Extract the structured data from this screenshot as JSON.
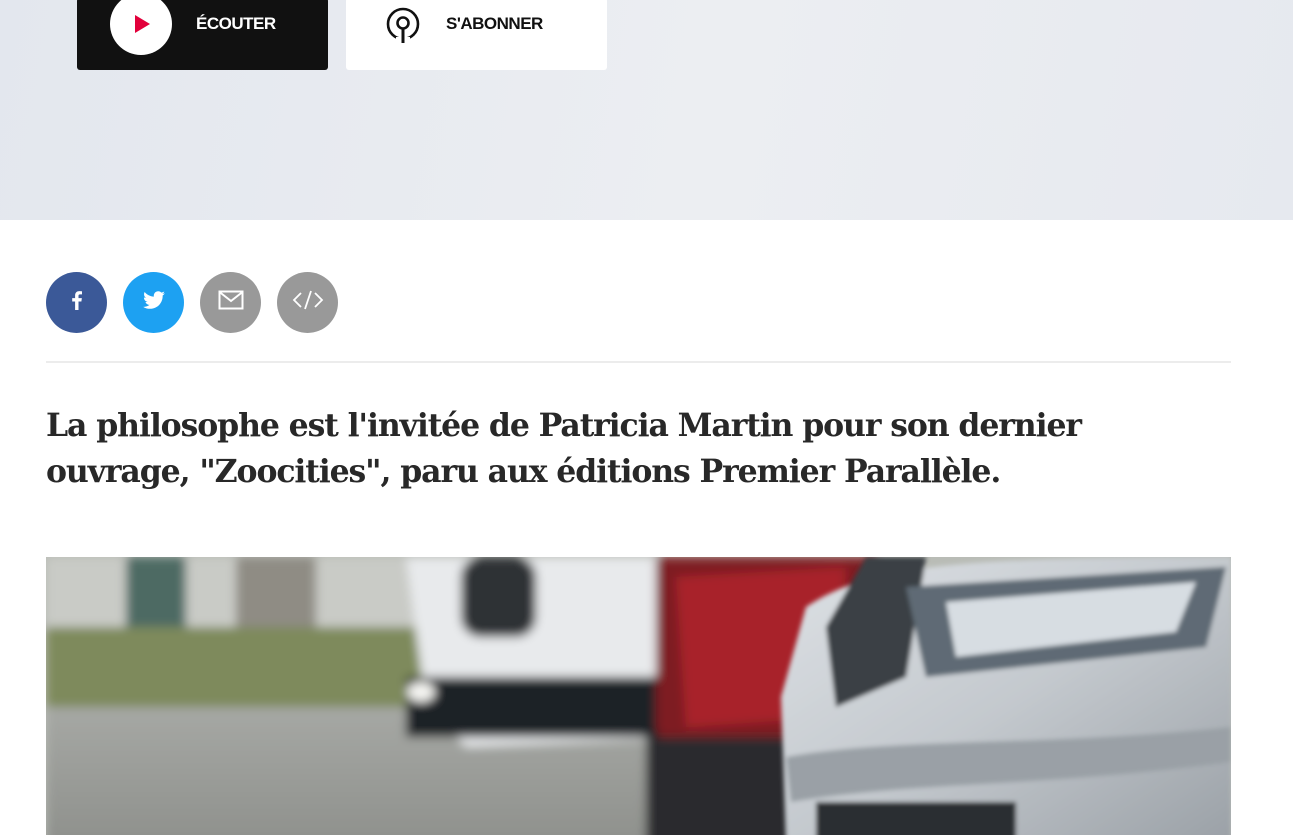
{
  "hero": {
    "listen_label": "ÉCOUTER",
    "subscribe_label": "S'ABONNER"
  },
  "share": {
    "facebook_icon": "facebook-icon",
    "twitter_icon": "twitter-icon",
    "email_icon": "mail-icon",
    "embed_icon": "code-icon"
  },
  "article": {
    "chapo": "La philosophe est l'invitée de Patricia Martin pour son dernier ouvrage, \"Zoocities\", paru aux éditions Premier Parallèle."
  },
  "colors": {
    "accent_red": "#e2003b",
    "facebook": "#3b5998",
    "twitter": "#1da1f2",
    "neutral_icon_bg": "#999999"
  }
}
